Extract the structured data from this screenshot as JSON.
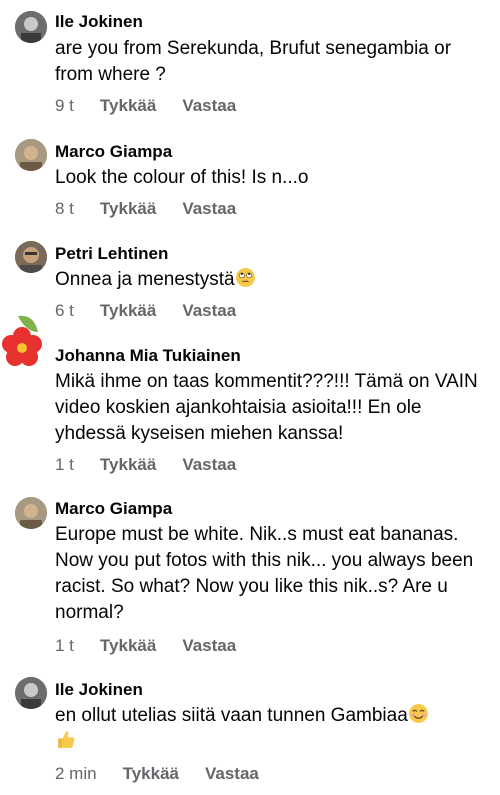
{
  "comments": [
    {
      "author": "Ile Jokinen",
      "text": "are you from Serekunda, Brufut senegambia or from where ?",
      "time": "9 t",
      "like": "Tykkää",
      "reply": "Vastaa"
    },
    {
      "author": "Marco Giampa",
      "text": "Look the colour of this! Is n...o",
      "time": "8 t",
      "like": "Tykkää",
      "reply": "Vastaa"
    },
    {
      "author": "Petri Lehtinen",
      "text": "Onnea ja menestystä",
      "time": "6 t",
      "like": "Tykkää",
      "reply": "Vastaa",
      "emoji": "rolling-eyes-emoji"
    },
    {
      "author": "Johanna Mia Tukiainen",
      "text": "Mikä ihme on taas kommentit???!!! Tämä on VAIN video koskien ajankohtaisia asioita!!! En ole yhdessä kyseisen miehen kanssa!",
      "time": "1 t",
      "like": "Tykkää",
      "reply": "Vastaa"
    },
    {
      "author": "Marco Giampa",
      "text": "Europe must be white. Nik..s must eat bananas. Now you put fotos with this nik... you always been racist. So what? Now you like this nik..s? Are u normal?",
      "time": "1 t",
      "like": "Tykkää",
      "reply": "Vastaa"
    },
    {
      "author": "Ile Jokinen",
      "text": "en ollut utelias siitä vaan tunnen Gambiaa",
      "time": "2 min",
      "like": "Tykkää",
      "reply": "Vastaa",
      "emoji": "smiling-emoji thumbs-up-emoji"
    }
  ]
}
